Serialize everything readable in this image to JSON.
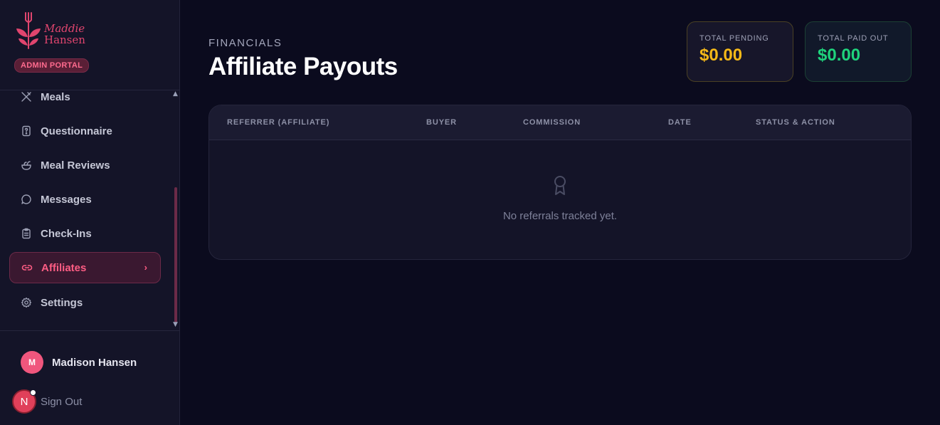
{
  "brand": {
    "line1": "Maddie",
    "line2": "Hansen",
    "badge": "ADMIN PORTAL",
    "accent": "#e0456e"
  },
  "nav": {
    "items": [
      {
        "label": "Meals",
        "icon": "utensils-icon"
      },
      {
        "label": "Questionnaire",
        "icon": "question-file-icon"
      },
      {
        "label": "Meal Reviews",
        "icon": "salad-bowl-icon"
      },
      {
        "label": "Messages",
        "icon": "chat-bubble-icon"
      },
      {
        "label": "Check-Ins",
        "icon": "clipboard-icon"
      },
      {
        "label": "Affiliates",
        "icon": "link-icon",
        "active": true
      },
      {
        "label": "Settings",
        "icon": "gear-icon"
      }
    ],
    "active_chevron": "›"
  },
  "user": {
    "initial": "M",
    "name": "Madison Hansen"
  },
  "signout": {
    "badge": "N",
    "label": "Sign Out"
  },
  "header": {
    "eyebrow": "FINANCIALS",
    "title": "Affiliate Payouts"
  },
  "stats": {
    "pending": {
      "label": "TOTAL PENDING",
      "value": "$0.00",
      "color": "#f5b918"
    },
    "paid": {
      "label": "TOTAL PAID OUT",
      "value": "$0.00",
      "color": "#1fd37c"
    }
  },
  "table": {
    "columns": [
      "REFERRER (AFFILIATE)",
      "BUYER",
      "COMMISSION",
      "DATE",
      "STATUS & ACTION"
    ],
    "empty_icon": "award-ribbon-icon",
    "empty_text": "No referrals tracked yet."
  }
}
